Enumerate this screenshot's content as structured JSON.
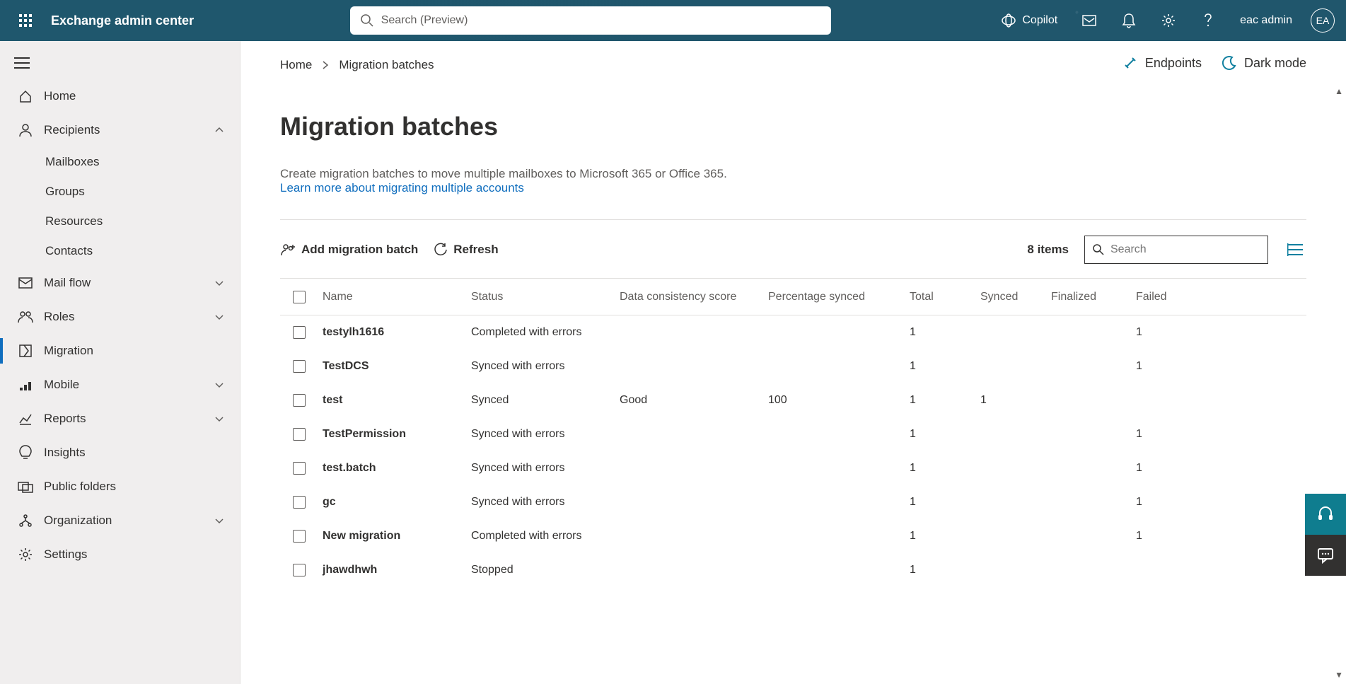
{
  "header": {
    "app_title": "Exchange admin center",
    "search_placeholder": "Search (Preview)",
    "copilot": "Copilot",
    "user_name": "eac admin",
    "avatar": "EA"
  },
  "sidebar": {
    "items": [
      {
        "label": "Home",
        "expandable": false
      },
      {
        "label": "Recipients",
        "expandable": true,
        "expanded": true
      },
      {
        "label": "Mail flow",
        "expandable": true
      },
      {
        "label": "Roles",
        "expandable": true
      },
      {
        "label": "Migration",
        "active": true
      },
      {
        "label": "Mobile",
        "expandable": true
      },
      {
        "label": "Reports",
        "expandable": true
      },
      {
        "label": "Insights"
      },
      {
        "label": "Public folders"
      },
      {
        "label": "Organization",
        "expandable": true
      },
      {
        "label": "Settings"
      }
    ],
    "recipients_sub": [
      "Mailboxes",
      "Groups",
      "Resources",
      "Contacts"
    ]
  },
  "breadcrumb": {
    "home": "Home",
    "current": "Migration batches"
  },
  "page": {
    "title": "Migration batches",
    "desc": "Create migration batches to move multiple mailboxes to Microsoft 365 or Office 365.",
    "link": "Learn more about migrating multiple accounts",
    "endpoints": "Endpoints",
    "dark_mode": "Dark mode"
  },
  "toolbar": {
    "add": "Add migration batch",
    "refresh": "Refresh",
    "count": "8 items",
    "search_placeholder": "Search"
  },
  "table": {
    "headers": [
      "Name",
      "Status",
      "Data consistency score",
      "Percentage synced",
      "Total",
      "Synced",
      "Finalized",
      "Failed"
    ],
    "rows": [
      {
        "name": "testylh1616",
        "status": "Completed with errors",
        "dcs": "",
        "pct": "",
        "total": "1",
        "synced": "",
        "finalized": "",
        "failed": "1"
      },
      {
        "name": "TestDCS",
        "status": "Synced with errors",
        "dcs": "",
        "pct": "",
        "total": "1",
        "synced": "",
        "finalized": "",
        "failed": "1"
      },
      {
        "name": "test",
        "status": "Synced",
        "dcs": "Good",
        "pct": "100",
        "total": "1",
        "synced": "1",
        "finalized": "",
        "failed": ""
      },
      {
        "name": "TestPermission",
        "status": "Synced with errors",
        "dcs": "",
        "pct": "",
        "total": "1",
        "synced": "",
        "finalized": "",
        "failed": "1"
      },
      {
        "name": "test.batch",
        "status": "Synced with errors",
        "dcs": "",
        "pct": "",
        "total": "1",
        "synced": "",
        "finalized": "",
        "failed": "1"
      },
      {
        "name": "gc",
        "status": "Synced with errors",
        "dcs": "",
        "pct": "",
        "total": "1",
        "synced": "",
        "finalized": "",
        "failed": "1"
      },
      {
        "name": "New migration",
        "status": "Completed with errors",
        "dcs": "",
        "pct": "",
        "total": "1",
        "synced": "",
        "finalized": "",
        "failed": "1"
      },
      {
        "name": "jhawdhwh",
        "status": "Stopped",
        "dcs": "",
        "pct": "",
        "total": "1",
        "synced": "",
        "finalized": "",
        "failed": ""
      }
    ]
  }
}
